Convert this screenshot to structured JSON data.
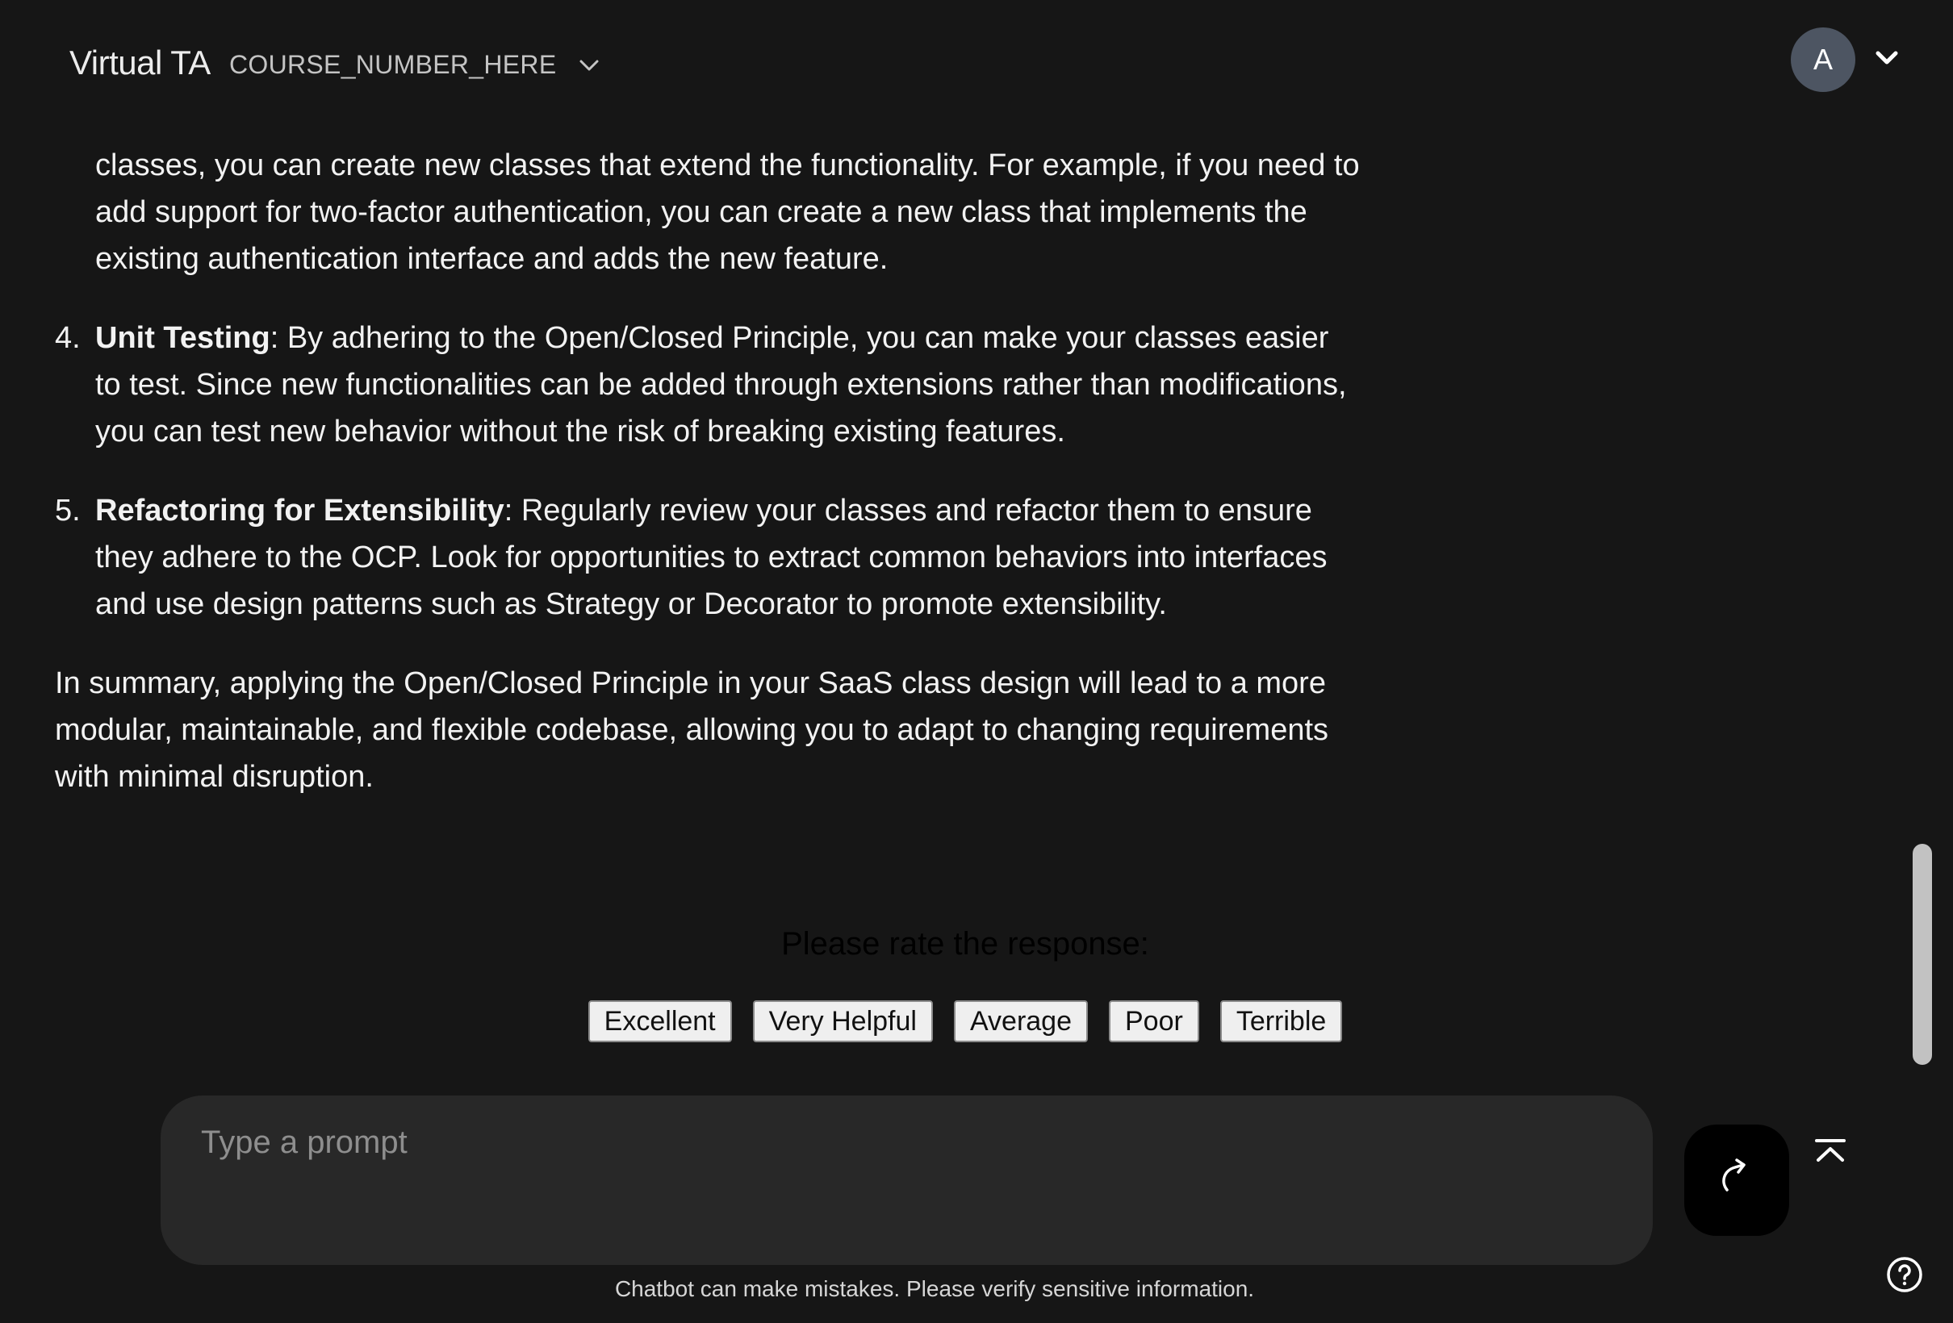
{
  "header": {
    "app_title": "Virtual TA",
    "course_label": "COURSE_NUMBER_HERE",
    "course_chevron_icon": "chevron-down-icon",
    "avatar_letter": "A",
    "avatar_color": "#4d5562",
    "account_chevron_icon": "chevron-down-icon"
  },
  "message": {
    "intro_continuation": "classes, you can create new classes that extend the functionality. For example, if you need to add support for two-factor authentication, you can create a new class that implements the existing authentication interface and adds the new feature.",
    "items": [
      {
        "number": "4.",
        "title": "Unit Testing",
        "text": ": By adhering to the Open/Closed Principle, you can make your classes easier to test. Since new functionalities can be added through extensions rather than modifications, you can test new behavior without the risk of breaking existing features."
      },
      {
        "number": "5.",
        "title": "Refactoring for Extensibility",
        "text": ": Regularly review your classes and refactor them to ensure they adhere to the OCP. Look for opportunities to extract common behaviors into interfaces and use design patterns such as Strategy or Decorator to promote extensibility."
      }
    ],
    "summary": "In summary, applying the Open/Closed Principle in your SaaS class design will lead to a more modular, maintainable, and flexible codebase, allowing you to adapt to changing requirements with minimal disruption."
  },
  "rating": {
    "prompt": "Please rate the response:",
    "options": [
      "Excellent",
      "Very Helpful",
      "Average",
      "Poor",
      "Terrible"
    ]
  },
  "input": {
    "placeholder": "Type a prompt",
    "value": "",
    "send_icon": "send-arrow-icon",
    "scroll_top_icon": "scroll-to-top-icon"
  },
  "footer": {
    "disclaimer": "Chatbot can make mistakes. Please verify sensitive information.",
    "help_icon": "help-icon"
  },
  "colors": {
    "background": "#161616",
    "input_background": "#282828",
    "send_button": "#000000",
    "scrollbar_thumb": "#c2c2c2"
  }
}
